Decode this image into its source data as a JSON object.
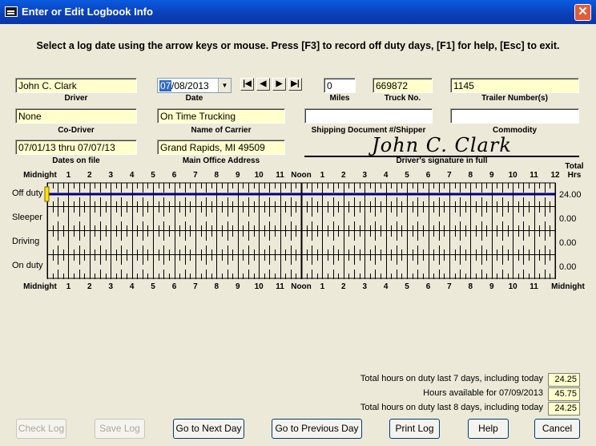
{
  "window": {
    "title": "Enter or Edit Logbook Info",
    "close": "✕"
  },
  "instructions": "Select a log date using the arrow keys or mouse.  Press [F3] to record off duty days, [F1] for help, [Esc] to exit.",
  "fields": {
    "driver": {
      "label": "Driver",
      "value": "John C. Clark"
    },
    "date": {
      "label": "Date",
      "selected": "07",
      "rest": "/08/2013"
    },
    "miles": {
      "label": "Miles",
      "value": "0"
    },
    "truck_no": {
      "label": "Truck No.",
      "value": "669872"
    },
    "trailer": {
      "label": "Trailer Number(s)",
      "value": "1145"
    },
    "co_driver": {
      "label": "Co-Driver",
      "value": "None"
    },
    "carrier": {
      "label": "Name of Carrier",
      "value": "On Time Trucking"
    },
    "shipping_doc": {
      "label": "Shipping Document #/Shipper",
      "value": ""
    },
    "commodity": {
      "label": "Commodity",
      "value": ""
    },
    "dates_on_file": {
      "label": "Dates on file",
      "value": "07/01/13 thru 07/07/13"
    },
    "office": {
      "label": "Main Office Address",
      "value": "Grand Rapids, MI  49509"
    },
    "signature": {
      "label": "Driver's signature in full",
      "value": "John C. Clark"
    }
  },
  "nav": [
    "|◀",
    "◀",
    "▶",
    "▶|"
  ],
  "grid": {
    "hours": [
      "Midnight",
      "1",
      "2",
      "3",
      "4",
      "5",
      "6",
      "7",
      "8",
      "9",
      "10",
      "11",
      "Noon",
      "1",
      "2",
      "3",
      "4",
      "5",
      "6",
      "7",
      "8",
      "9",
      "10",
      "11",
      "12"
    ],
    "hours_bottom": [
      "Midnight",
      "1",
      "2",
      "3",
      "4",
      "5",
      "6",
      "7",
      "8",
      "9",
      "10",
      "11",
      "Noon",
      "1",
      "2",
      "3",
      "4",
      "5",
      "6",
      "7",
      "8",
      "9",
      "10",
      "11",
      "Midnight"
    ],
    "total_header": [
      "Total",
      "Hrs"
    ],
    "rows": [
      {
        "label": "Off duty",
        "total": "24.00"
      },
      {
        "label": "Sleeper",
        "total": "0.00"
      },
      {
        "label": "Driving",
        "total": "0.00"
      },
      {
        "label": "On duty",
        "total": "0.00"
      }
    ],
    "status_line_color": "#000080"
  },
  "summary": [
    {
      "label": "Total hours on duty last 7 days, including today",
      "value": "24.25"
    },
    {
      "label": "Hours available for 07/09/2013",
      "value": "45.75"
    },
    {
      "label": "Total hours on duty last 8 days, including today",
      "value": "24.25"
    }
  ],
  "buttons": {
    "check": "Check Log",
    "save": "Save Log",
    "next": "Go to Next Day",
    "prev": "Go to Previous Day",
    "print": "Print Log",
    "help": "Help",
    "cancel": "Cancel"
  }
}
